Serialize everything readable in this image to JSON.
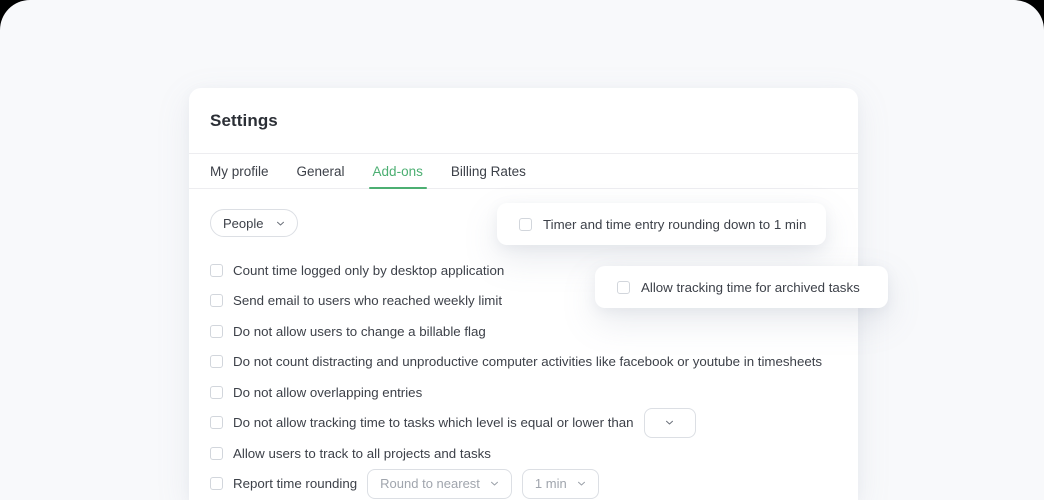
{
  "theme": {
    "page_bg": "#f8f9fb",
    "card_bg": "#ffffff",
    "accent": "#4caf72",
    "text": "#3d4149",
    "title_text": "#2b2f36",
    "muted_text": "#a0a5ad",
    "border": "#dcdfe4",
    "checkbox_border": "#d2d6dc"
  },
  "header": {
    "title": "Settings"
  },
  "tabs": [
    {
      "label": "My profile",
      "active": false
    },
    {
      "label": "General",
      "active": false
    },
    {
      "label": "Add-ons",
      "active": true
    },
    {
      "label": "Billing Rates",
      "active": false
    }
  ],
  "filter": {
    "scope_select": {
      "value": "People",
      "icon": "chevron-down-icon"
    }
  },
  "options": [
    {
      "label": "Count time logged only by desktop application",
      "checked": false
    },
    {
      "label": "Send email to users who reached weekly limit",
      "checked": false
    },
    {
      "label": "Do not allow users to change a billable flag",
      "checked": false
    },
    {
      "label": "Do not count distracting and unproductive computer activities like facebook or youtube in timesheets",
      "checked": false
    },
    {
      "label": "Do not allow overlapping entries",
      "checked": false
    },
    {
      "label": "Do not allow tracking time to tasks which level is equal or lower than",
      "checked": false
    },
    {
      "label": "Allow users to track to all projects and tasks",
      "checked": false
    },
    {
      "label": "Report time rounding",
      "checked": false
    }
  ],
  "level_select": {
    "value": "",
    "icon": "chevron-down-icon"
  },
  "rounding_selects": [
    {
      "value": "Round to nearest",
      "icon": "chevron-down-icon"
    },
    {
      "value": "1 min",
      "icon": "chevron-down-icon"
    }
  ],
  "floating_cards": [
    {
      "label": "Timer and time entry rounding down to 1 min",
      "checked": false
    },
    {
      "label": "Allow tracking time for archived tasks",
      "checked": false
    }
  ]
}
